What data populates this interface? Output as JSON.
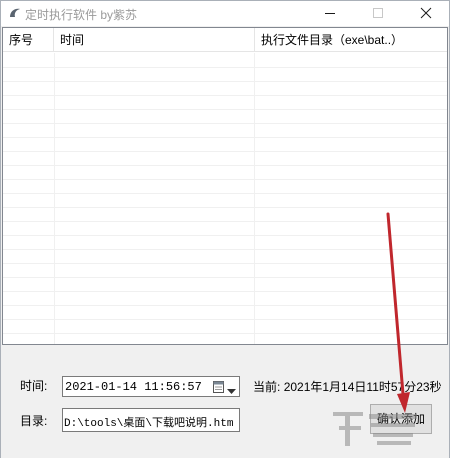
{
  "window": {
    "title": "定时执行软件 by紫苏",
    "icon": "app-swirl-icon",
    "controls": [
      "minimize-icon",
      "maximize-icon",
      "close-icon"
    ]
  },
  "list": {
    "columns": [
      {
        "label": "序号"
      },
      {
        "label": "时间"
      },
      {
        "label": "执行文件目录（exe\\bat..）"
      }
    ],
    "rows": []
  },
  "form": {
    "time_label": "时间:",
    "time_value_date": "2021-01-14",
    "time_value_clock": "11:56:57",
    "now_label": "当前:",
    "now_value": "2021年1月14日11时57分23秒",
    "dir_label": "目录:",
    "dir_value": "D:\\tools\\桌面\\下载吧说明.htm",
    "add_button_label": "确认添加"
  },
  "colors": {
    "annotation_arrow": "#c0272d",
    "title_text": "#9a9a9a",
    "window_bg": "#f0f0f0"
  }
}
